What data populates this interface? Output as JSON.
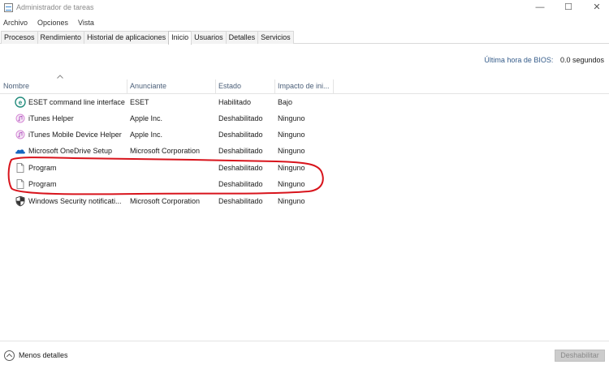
{
  "window": {
    "title": "Administrador de tareas",
    "controls": {
      "minimize": "—",
      "maximize": "☐",
      "close": "✕"
    }
  },
  "menu": [
    "Archivo",
    "Opciones",
    "Vista"
  ],
  "tabs": [
    {
      "label": "Procesos",
      "active": false
    },
    {
      "label": "Rendimiento",
      "active": false
    },
    {
      "label": "Historial de aplicaciones",
      "active": false
    },
    {
      "label": "Inicio",
      "active": true
    },
    {
      "label": "Usuarios",
      "active": false
    },
    {
      "label": "Detalles",
      "active": false
    },
    {
      "label": "Servicios",
      "active": false
    }
  ],
  "bios": {
    "label": "Última hora de BIOS:",
    "value": "0.0 segundos"
  },
  "columns": [
    "Nombre",
    "Anunciante",
    "Estado",
    "Impacto de ini..."
  ],
  "rows": [
    {
      "icon": "eset-icon",
      "name": "ESET command line interface",
      "publisher": "ESET",
      "status": "Habilitado",
      "impact": "Bajo"
    },
    {
      "icon": "itunes-icon",
      "name": "iTunes Helper",
      "publisher": "Apple Inc.",
      "status": "Deshabilitado",
      "impact": "Ninguno"
    },
    {
      "icon": "itunes-icon",
      "name": "iTunes Mobile Device Helper",
      "publisher": "Apple Inc.",
      "status": "Deshabilitado",
      "impact": "Ninguno"
    },
    {
      "icon": "onedrive-icon",
      "name": "Microsoft OneDrive Setup",
      "publisher": "Microsoft Corporation",
      "status": "Deshabilitado",
      "impact": "Ninguno"
    },
    {
      "icon": "file-icon",
      "name": "Program",
      "publisher": "",
      "status": "Deshabilitado",
      "impact": "Ninguno"
    },
    {
      "icon": "file-icon",
      "name": "Program",
      "publisher": "",
      "status": "Deshabilitado",
      "impact": "Ninguno"
    },
    {
      "icon": "shield-icon",
      "name": "Windows Security notificati...",
      "publisher": "Microsoft Corporation",
      "status": "Deshabilitado",
      "impact": "Ninguno"
    }
  ],
  "footer": {
    "less_details": "Menos detalles",
    "disable_button": "Deshabilitar"
  },
  "colors": {
    "annotation": "#d8141c",
    "header_text": "#4c607a",
    "bios_label": "#355c8a"
  }
}
